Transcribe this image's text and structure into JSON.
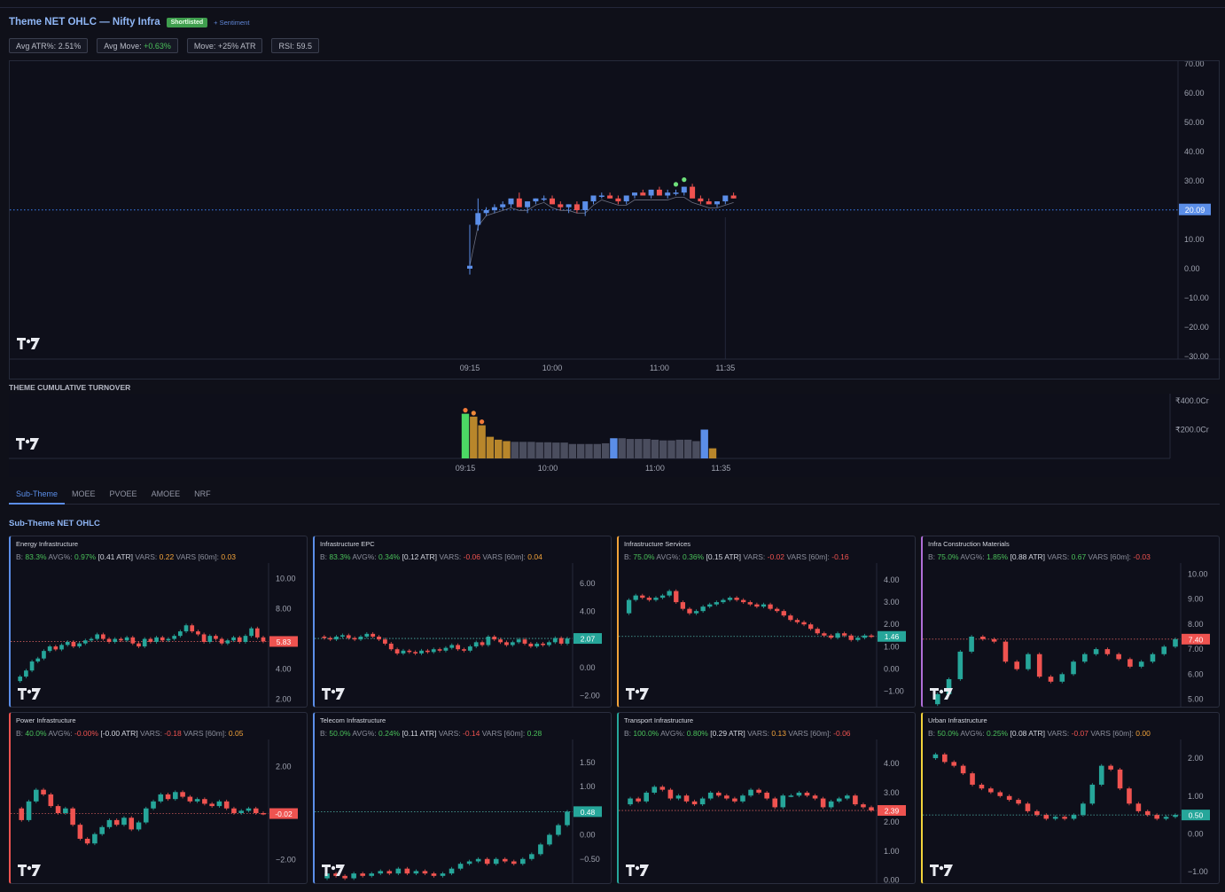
{
  "header": {
    "title": "Theme NET OHLC — Nifty Infra",
    "badge": "Shortlisted",
    "sentiment_link": "+ Sentiment",
    "stats": [
      {
        "label": "Avg ATR%: ",
        "value": "2.51%",
        "color": "#b9bcc7"
      },
      {
        "label": "Avg Move: ",
        "value": "+0.63%",
        "color": "#4ac05a"
      },
      {
        "label": "Move: ",
        "value": "+25% ATR",
        "color": "#b9bcc7"
      },
      {
        "label": "RSI: ",
        "value": "59.5",
        "color": "#b9bcc7"
      }
    ]
  },
  "colors": {
    "up": "#5b8ee8",
    "down": "#ef5350",
    "card_up": "#26a69a",
    "card_down": "#ef5350",
    "accent": "#5b8ee8"
  },
  "main_chart": {
    "y_ticks": [
      "70.00",
      "60.00",
      "50.00",
      "40.00",
      "30.00",
      "20.00",
      "10.00",
      "0.00",
      "−10.00",
      "−20.00",
      "−30.00"
    ],
    "y_min": -30,
    "y_max": 70,
    "last_price": "20.09",
    "last_value": 20.09,
    "x_ticks": [
      "09:15",
      "10:00",
      "11:00",
      "11:35"
    ],
    "candles": [
      [
        0,
        0,
        15,
        -2,
        1
      ],
      [
        1,
        15,
        24,
        13,
        19
      ],
      [
        2,
        19,
        21,
        18,
        20
      ],
      [
        3,
        20,
        22,
        19,
        21
      ],
      [
        4,
        21,
        23,
        20,
        22
      ],
      [
        5,
        22,
        23,
        21,
        24
      ],
      [
        6,
        24,
        26,
        22,
        21
      ],
      [
        7,
        21,
        22,
        19,
        23
      ],
      [
        8,
        23,
        24,
        22,
        24
      ],
      [
        9,
        24,
        25,
        23,
        24
      ],
      [
        10,
        24,
        25,
        22,
        22
      ],
      [
        11,
        22,
        23,
        20,
        21
      ],
      [
        12,
        21,
        22,
        19,
        22
      ],
      [
        13,
        22,
        23,
        19,
        20
      ],
      [
        14,
        20,
        21,
        18,
        23
      ],
      [
        15,
        23,
        24,
        22,
        25
      ],
      [
        16,
        25,
        26,
        24,
        25
      ],
      [
        17,
        25,
        26,
        24,
        24
      ],
      [
        18,
        24,
        25,
        22,
        23
      ],
      [
        19,
        23,
        24,
        22,
        25
      ],
      [
        20,
        25,
        26,
        24,
        26
      ],
      [
        21,
        26,
        27,
        25,
        25
      ],
      [
        22,
        25,
        27,
        24,
        27
      ],
      [
        23,
        27,
        28,
        26,
        25
      ],
      [
        24,
        25,
        27,
        24,
        26
      ],
      [
        25,
        26,
        27,
        25,
        26
      ],
      [
        26,
        26,
        28,
        25,
        28
      ],
      [
        27,
        28,
        29,
        25,
        24
      ],
      [
        28,
        24,
        25,
        22,
        23
      ],
      [
        29,
        23,
        24,
        22,
        22
      ],
      [
        30,
        22,
        23,
        21,
        23
      ],
      [
        31,
        23,
        25,
        22,
        25
      ],
      [
        32,
        25,
        26,
        24,
        24
      ]
    ],
    "markers": [
      25,
      26
    ]
  },
  "turnover": {
    "title": "THEME CUMULATIVE TURNOVER",
    "y_ticks": [
      "₹400.0Cr",
      "₹200.0Cr"
    ],
    "x_ticks": [
      "09:15",
      "10:00",
      "11:00",
      "11:35"
    ],
    "bars": [
      {
        "v": 310,
        "c": "#4cd964"
      },
      {
        "v": 290,
        "c": "#b8862b"
      },
      {
        "v": 230,
        "c": "#b8862b"
      },
      {
        "v": 150,
        "c": "#b8862b"
      },
      {
        "v": 130,
        "c": "#b8862b"
      },
      {
        "v": 120,
        "c": "#b8862b"
      },
      {
        "v": 115,
        "c": "#4a4d5e"
      },
      {
        "v": 115,
        "c": "#4a4d5e"
      },
      {
        "v": 115,
        "c": "#4a4d5e"
      },
      {
        "v": 112,
        "c": "#4a4d5e"
      },
      {
        "v": 112,
        "c": "#4a4d5e"
      },
      {
        "v": 110,
        "c": "#4a4d5e"
      },
      {
        "v": 110,
        "c": "#4a4d5e"
      },
      {
        "v": 100,
        "c": "#4a4d5e"
      },
      {
        "v": 100,
        "c": "#4a4d5e"
      },
      {
        "v": 100,
        "c": "#4a4d5e"
      },
      {
        "v": 100,
        "c": "#4a4d5e"
      },
      {
        "v": 105,
        "c": "#4a4d5e"
      },
      {
        "v": 140,
        "c": "#5b8ee8"
      },
      {
        "v": 140,
        "c": "#4a4d5e"
      },
      {
        "v": 135,
        "c": "#4a4d5e"
      },
      {
        "v": 135,
        "c": "#4a4d5e"
      },
      {
        "v": 135,
        "c": "#4a4d5e"
      },
      {
        "v": 130,
        "c": "#4a4d5e"
      },
      {
        "v": 125,
        "c": "#4a4d5e"
      },
      {
        "v": 125,
        "c": "#4a4d5e"
      },
      {
        "v": 130,
        "c": "#4a4d5e"
      },
      {
        "v": 130,
        "c": "#4a4d5e"
      },
      {
        "v": 120,
        "c": "#4a4d5e"
      },
      {
        "v": 200,
        "c": "#5b8ee8"
      },
      {
        "v": 70,
        "c": "#b8862b"
      }
    ],
    "markers": [
      0,
      1,
      2
    ]
  },
  "tabs": [
    "Sub-Theme",
    "MOEE",
    "PVOEE",
    "AMOEE",
    "NRF"
  ],
  "subtheme_heading": "Sub-Theme NET OHLC",
  "cards": [
    {
      "name": "Energy Infrastructure",
      "b": "83.3%",
      "avg": "0.97%",
      "atr": "[0.41 ATR]",
      "vars": "0.22",
      "vars60": "0.03",
      "avg_c": "g",
      "vars_c": "o",
      "vars60_c": "o",
      "border": "#5b8ee8",
      "last": "5.83",
      "last_v": 5.83,
      "tag": "#ef5350",
      "ticks": [
        "10.00",
        "8.00",
        "4.00",
        "2.00"
      ],
      "tick_v": [
        10,
        8,
        4,
        2
      ],
      "y_min": 1.5,
      "y_max": 10.8,
      "series": [
        3.2,
        3.5,
        3.9,
        4.5,
        4.7,
        5.2,
        5.5,
        5.3,
        5.6,
        5.8,
        5.5,
        5.7,
        5.9,
        6.0,
        6.3,
        6.0,
        5.8,
        6.0,
        5.9,
        6.1,
        5.7,
        5.5,
        6.0,
        5.8,
        6.1,
        5.9,
        6.0,
        6.2,
        6.5,
        6.9,
        6.5,
        6.3,
        5.8,
        6.2,
        6.0,
        5.7,
        5.9,
        6.1,
        5.8,
        6.2,
        6.7,
        6.1,
        5.83
      ]
    },
    {
      "name": "Infrastructure EPC",
      "b": "83.3%",
      "avg": "0.34%",
      "atr": "[0.12 ATR]",
      "vars": "-0.06",
      "vars60": "0.04",
      "avg_c": "g",
      "vars_c": "r",
      "vars60_c": "o",
      "border": "#5b8ee8",
      "last": "2.07",
      "last_v": 2.07,
      "tag": "#26a69a",
      "ticks": [
        "6.00",
        "4.00",
        "0.00",
        "−2.00"
      ],
      "tick_v": [
        6,
        4,
        0,
        -2
      ],
      "y_min": -2.8,
      "y_max": 7.2,
      "series": [
        2.2,
        2.1,
        2.0,
        2.2,
        2.3,
        2.1,
        2.0,
        2.2,
        2.4,
        2.2,
        2.0,
        1.7,
        1.3,
        1.0,
        1.2,
        1.1,
        1.0,
        1.2,
        1.1,
        1.3,
        1.2,
        1.4,
        1.6,
        1.3,
        1.2,
        1.5,
        1.8,
        1.6,
        2.2,
        2.0,
        1.8,
        1.6,
        1.8,
        2.0,
        1.7,
        1.5,
        1.7,
        1.6,
        1.8,
        2.1,
        1.7,
        2.07
      ]
    },
    {
      "name": "Infrastructure Services",
      "b": "75.0%",
      "avg": "0.36%",
      "atr": "[0.15 ATR]",
      "vars": "-0.02",
      "vars60": "-0.16",
      "avg_c": "g",
      "vars_c": "r",
      "vars60_c": "r",
      "border": "#f2a33a",
      "last": "1.46",
      "last_v": 1.46,
      "tag": "#26a69a",
      "ticks": [
        "4.00",
        "3.00",
        "2.00",
        "1.00",
        "0.00",
        "−1.00"
      ],
      "tick_v": [
        4,
        3,
        2,
        1,
        0,
        -1
      ],
      "y_min": -1.7,
      "y_max": 4.6,
      "series": [
        2.5,
        3.1,
        3.3,
        3.2,
        3.1,
        3.2,
        3.3,
        3.5,
        3.0,
        2.7,
        2.5,
        2.6,
        2.8,
        2.9,
        3.0,
        3.1,
        3.2,
        3.1,
        3.0,
        2.9,
        2.8,
        2.9,
        2.7,
        2.6,
        2.4,
        2.2,
        2.1,
        2.0,
        1.8,
        1.6,
        1.5,
        1.4,
        1.6,
        1.5,
        1.3,
        1.4,
        1.5,
        1.46
      ]
    },
    {
      "name": "Infra Construction Materials",
      "b": "75.0%",
      "avg": "1.85%",
      "atr": "[0.88 ATR]",
      "vars": "0.67",
      "vars60": "-0.03",
      "avg_c": "g",
      "vars_c": "g",
      "vars60_c": "r",
      "border": "#b06ed8",
      "last": "7.40",
      "last_v": 7.4,
      "tag": "#ef5350",
      "ticks": [
        "10.00",
        "9.00",
        "8.00",
        "7.00",
        "6.00",
        "5.00"
      ],
      "tick_v": [
        10,
        9,
        8,
        7,
        6,
        5
      ],
      "y_min": 4.7,
      "y_max": 10.3,
      "series": [
        4.8,
        5.2,
        5.8,
        6.9,
        7.5,
        7.4,
        7.3,
        6.5,
        6.2,
        6.8,
        5.9,
        5.7,
        6.0,
        6.5,
        6.8,
        7.0,
        6.8,
        6.6,
        6.3,
        6.5,
        6.8,
        7.1,
        7.4
      ]
    },
    {
      "name": "Power Infrastructure",
      "b": "40.0%",
      "avg": "-0.00%",
      "atr": "[-0.00 ATR]",
      "vars": "-0.18",
      "vars60": "0.05",
      "avg_c": "r",
      "vars_c": "r",
      "vars60_c": "o",
      "border": "#ef5350",
      "last": "-0.02",
      "last_v": -0.02,
      "tag": "#ef5350",
      "ticks": [
        "2.00",
        "−2.00"
      ],
      "tick_v": [
        2,
        -2
      ],
      "y_min": -3.0,
      "y_max": 3.0,
      "series": [
        0.2,
        -0.3,
        0.5,
        1.0,
        0.8,
        0.3,
        0.0,
        0.2,
        -0.5,
        -1.1,
        -1.3,
        -0.9,
        -0.6,
        -0.3,
        -0.5,
        -0.2,
        -0.7,
        -0.4,
        0.2,
        0.5,
        0.8,
        0.6,
        0.9,
        0.7,
        0.5,
        0.6,
        0.4,
        0.3,
        0.5,
        0.2,
        0.0,
        0.1,
        0.2,
        0.0,
        -0.02
      ]
    },
    {
      "name": "Telecom Infrastructure",
      "b": "50.0%",
      "avg": "0.24%",
      "atr": "[0.11 ATR]",
      "vars": "-0.14",
      "vars60": "0.28",
      "avg_c": "g",
      "vars_c": "r",
      "vars60_c": "g",
      "border": "#5b8ee8",
      "last": "0.48",
      "last_v": 0.48,
      "tag": "#26a69a",
      "ticks": [
        "1.50",
        "1.00",
        "0.50",
        "0.00",
        "−0.50"
      ],
      "tick_v": [
        1.5,
        1,
        0.5,
        0,
        -0.5
      ],
      "y_min": -1.0,
      "y_max": 1.9,
      "series": [
        -0.9,
        -0.8,
        -0.85,
        -0.9,
        -0.8,
        -0.85,
        -0.8,
        -0.75,
        -0.8,
        -0.7,
        -0.8,
        -0.75,
        -0.8,
        -0.85,
        -0.8,
        -0.7,
        -0.6,
        -0.55,
        -0.5,
        -0.6,
        -0.5,
        -0.55,
        -0.6,
        -0.5,
        -0.4,
        -0.2,
        0.0,
        0.2,
        0.48
      ]
    },
    {
      "name": "Transport Infrastructure",
      "b": "100.0%",
      "avg": "0.80%",
      "atr": "[0.29 ATR]",
      "vars": "0.13",
      "vars60": "-0.06",
      "avg_c": "g",
      "vars_c": "o",
      "vars60_c": "r",
      "border": "#26a69a",
      "last": "2.39",
      "last_v": 2.39,
      "tag": "#ef5350",
      "ticks": [
        "4.00",
        "3.00",
        "2.00",
        "1.00",
        "0.00"
      ],
      "tick_v": [
        4,
        3,
        2,
        1,
        0
      ],
      "y_min": -0.1,
      "y_max": 4.7,
      "series": [
        2.6,
        2.8,
        2.7,
        3.0,
        3.2,
        3.1,
        2.8,
        2.9,
        2.7,
        2.6,
        2.8,
        3.0,
        2.9,
        2.8,
        2.7,
        2.9,
        3.1,
        3.0,
        2.8,
        2.5,
        2.9,
        2.9,
        3.0,
        2.9,
        2.8,
        2.5,
        2.7,
        2.8,
        2.9,
        2.6,
        2.5,
        2.39
      ]
    },
    {
      "name": "Urban Infrastructure",
      "b": "50.0%",
      "avg": "0.25%",
      "atr": "[0.08 ATR]",
      "vars": "-0.07",
      "vars60": "0.00",
      "avg_c": "g",
      "vars_c": "r",
      "vars60_c": "o",
      "border": "#f2d33a",
      "last": "0.50",
      "last_v": 0.5,
      "tag": "#26a69a",
      "ticks": [
        "2.00",
        "1.00",
        "0.00",
        "−1.00"
      ],
      "tick_v": [
        2,
        1,
        0,
        -1
      ],
      "y_min": -1.3,
      "y_max": 2.4,
      "series": [
        2.0,
        2.1,
        1.9,
        1.8,
        1.6,
        1.3,
        1.2,
        1.1,
        1.0,
        0.9,
        0.8,
        0.6,
        0.5,
        0.4,
        0.45,
        0.4,
        0.5,
        0.8,
        1.3,
        1.8,
        1.7,
        1.2,
        0.8,
        0.6,
        0.5,
        0.4,
        0.45,
        0.5
      ]
    }
  ]
}
